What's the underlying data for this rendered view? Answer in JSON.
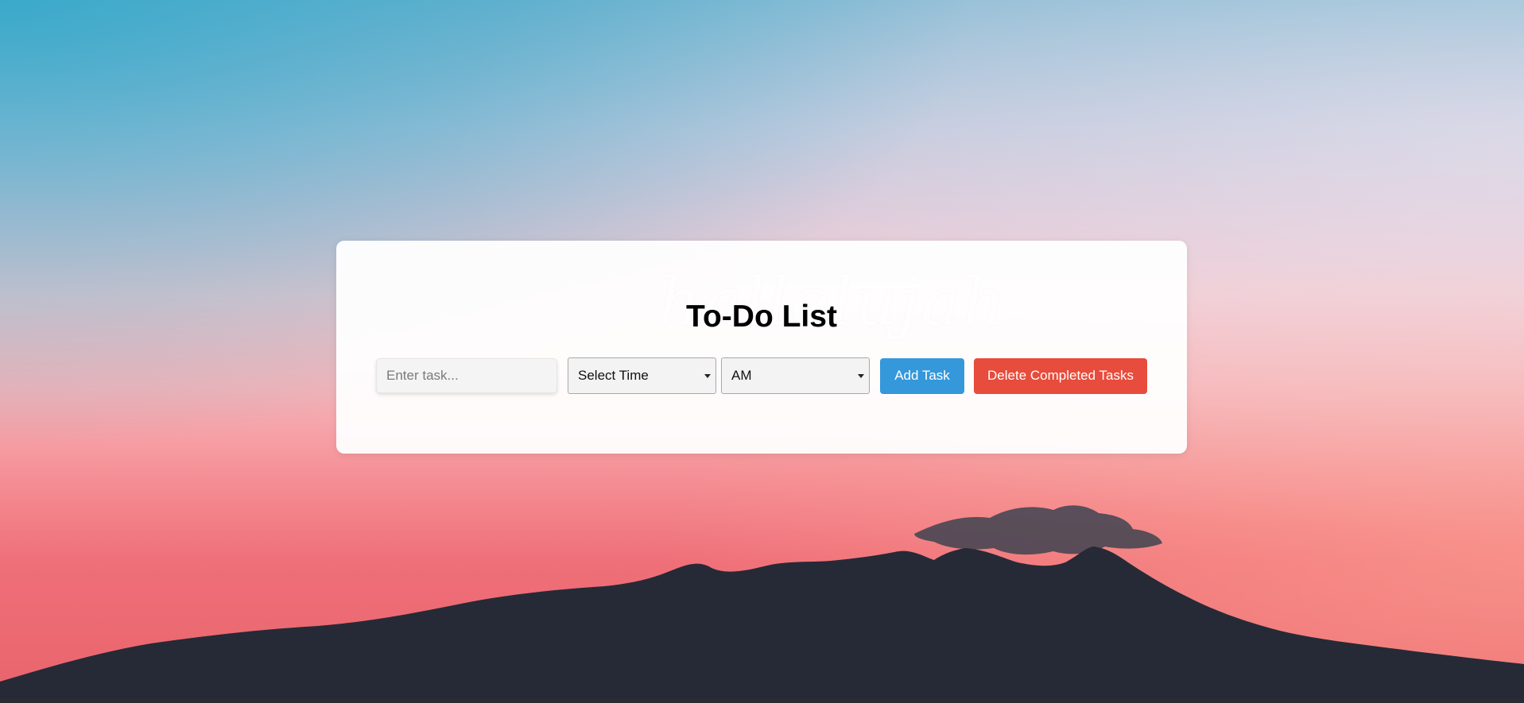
{
  "app": {
    "title": "To-Do List",
    "watermark_text": "hallelujah"
  },
  "form": {
    "task_input": {
      "placeholder": "Enter task...",
      "value": ""
    },
    "time_select": {
      "selected": "Select Time"
    },
    "ampm_select": {
      "selected": "AM"
    },
    "add_button_label": "Add Task",
    "delete_button_label": "Delete Completed Tasks"
  },
  "colors": {
    "add_button": "#3498db",
    "delete_button": "#e74c3c",
    "card_background": "#ffffff",
    "mountain": "#262a36"
  },
  "icons": {
    "select_arrow": "chevron-down-icon"
  }
}
